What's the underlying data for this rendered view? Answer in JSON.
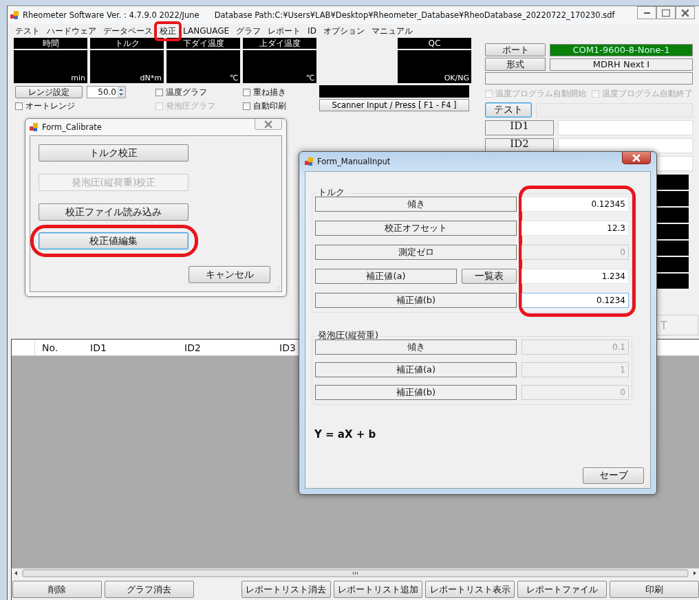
{
  "window": {
    "title": "Rheometer Software Ver. : 4.7.9.0  2022/June",
    "database_path": "Database Path:C:¥Users¥LAB¥Desktop¥Rheometer_Database¥RheoDatabase_20220722_170230.sdf"
  },
  "menu": [
    {
      "label": "テスト",
      "highlighted": false
    },
    {
      "label": "ハードウェア",
      "highlighted": false
    },
    {
      "label": "データベース",
      "highlighted": false
    },
    {
      "label": "校正",
      "highlighted": true
    },
    {
      "label": "LANGUAGE",
      "highlighted": false
    },
    {
      "label": "グラフ",
      "highlighted": false
    },
    {
      "label": "レポート",
      "highlighted": false
    },
    {
      "label": "ID",
      "highlighted": false
    },
    {
      "label": "オプション",
      "highlighted": false
    },
    {
      "label": "マニュアル",
      "highlighted": false
    }
  ],
  "displays": [
    {
      "kind": "meter",
      "header": "時間",
      "unit": "min"
    },
    {
      "kind": "meter",
      "header": "トルク",
      "unit": "dN*m"
    },
    {
      "kind": "meter",
      "header": "下ダイ温度",
      "unit": "℃"
    },
    {
      "kind": "meter",
      "header": "上ダイ温度",
      "unit": "℃"
    },
    {
      "kind": "blank"
    },
    {
      "kind": "meter",
      "header": "QC",
      "unit": "OK/NG"
    }
  ],
  "range_button": "レンジ設定",
  "range_value": "50.0",
  "checkboxes": [
    {
      "label": "温度グラフ",
      "checked": false,
      "disabled": false
    },
    {
      "label": "重ね描き",
      "checked": false,
      "disabled": false
    },
    {
      "label": "オートレンジ",
      "checked": false,
      "disabled": false
    },
    {
      "label": "発泡圧グラフ",
      "checked": false,
      "disabled": true
    },
    {
      "label": "自動印刷",
      "checked": false,
      "disabled": false
    }
  ],
  "scanner_button": "Scanner Input / Press [ F1 - F4 ]",
  "right_panel": {
    "port_button": "ポート",
    "port_value": "COM1-9600-8-None-1",
    "port_connected": true,
    "type_button": "形式",
    "type_value": "MDRH Next I",
    "auto_checkboxes": [
      {
        "label": "温度プログラム自動開始",
        "checked": false,
        "disabled": true
      },
      {
        "label": "温度プログラム自動終了",
        "checked": false,
        "disabled": true
      }
    ],
    "test_button": "テスト",
    "test_focused": true,
    "id_buttons": [
      "ID1",
      "ID2"
    ],
    "cut_button": "T"
  },
  "table": {
    "columns": [
      "No.",
      "ID1",
      "ID2",
      "ID3"
    ]
  },
  "bottom_buttons": [
    "削除",
    "グラフ消去",
    "レポートリスト消去",
    "レポートリスト追加",
    "レポートリスト表示",
    "レポートファイル",
    "印刷"
  ],
  "calibrate_dialog": {
    "title": "Form_Calibrate",
    "buttons": [
      {
        "label": "トルク校正",
        "disabled": false,
        "focused": false,
        "highlighted": false
      },
      {
        "label": "発泡圧(縦荷重)校正",
        "disabled": true,
        "focused": false,
        "highlighted": false
      },
      {
        "label": "校正ファイル読み込み",
        "disabled": false,
        "focused": false,
        "highlighted": false
      },
      {
        "label": "校正値編集",
        "disabled": false,
        "focused": true,
        "highlighted": true
      }
    ],
    "cancel_button": "キャンセル"
  },
  "manual_dialog": {
    "title": "Form_ManualInput",
    "groups": [
      {
        "title": "トルク",
        "values_highlighted": true,
        "rows": [
          {
            "label": "傾き",
            "value": "0.12345",
            "disabled": false,
            "focused": false
          },
          {
            "label": "校正オフセット",
            "value": "12.3",
            "disabled": false,
            "focused": false
          },
          {
            "label": "測定ゼロ",
            "value": "0",
            "disabled": true,
            "focused": false
          },
          {
            "label": "補正値(a)",
            "button": "一覧表",
            "value": "1.234",
            "disabled": false,
            "focused": false
          },
          {
            "label": "補正値(b)",
            "value": "0.1234",
            "disabled": false,
            "focused": true
          }
        ]
      },
      {
        "title": "発泡圧(縦荷重)",
        "values_highlighted": false,
        "rows": [
          {
            "label": "傾き",
            "value": "0.1",
            "disabled": true,
            "focused": false
          },
          {
            "label": "補正値(a)",
            "value": "1",
            "disabled": true,
            "focused": false
          },
          {
            "label": "補正値(b)",
            "value": "0",
            "disabled": true,
            "focused": false
          }
        ]
      }
    ],
    "formula": "Y = aX + b",
    "save_button": "セーブ"
  }
}
